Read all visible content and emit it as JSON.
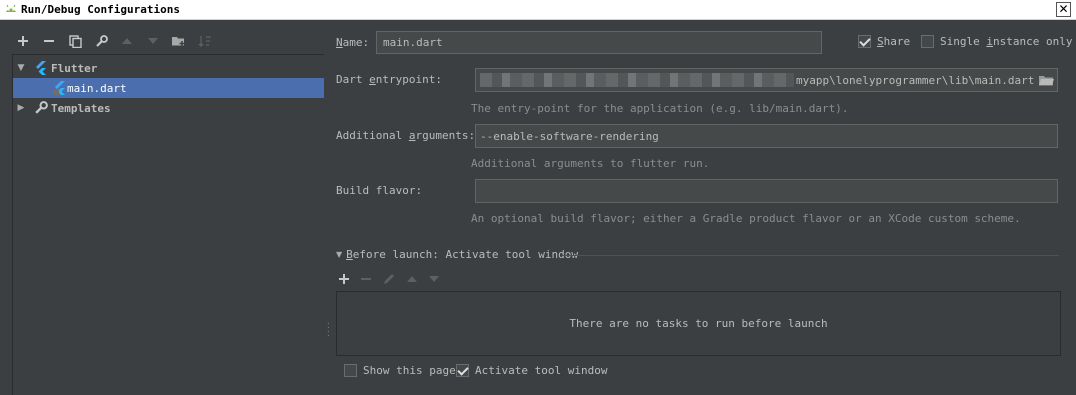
{
  "window": {
    "title": "Run/Debug Configurations",
    "close_glyph": "✕"
  },
  "toolbar": {
    "icons": [
      "add-icon",
      "remove-icon",
      "copy-icon",
      "wrench-icon",
      "move-up-icon",
      "move-down-icon",
      "folder-icon",
      "sort-icon"
    ]
  },
  "tree": {
    "items": [
      {
        "label": "Flutter",
        "expanded": true,
        "icon": "flutter-icon"
      },
      {
        "label": "main.dart",
        "selected": true,
        "icon": "flutter-run-icon"
      },
      {
        "label": "Templates",
        "expanded": false,
        "icon": "wrench-icon"
      }
    ]
  },
  "form": {
    "name_label_u": "N",
    "name_label_rest": "ame:",
    "name_value": "main.dart",
    "share_label_u": "S",
    "share_label_rest": "hare",
    "share_checked": true,
    "single_instance_label_pre": "Single ",
    "single_instance_label_u": "i",
    "single_instance_label_rest": "nstance only",
    "single_instance_checked": false,
    "entrypoint_label_pre": "Dart ",
    "entrypoint_label_u": "e",
    "entrypoint_label_rest": "ntrypoint:",
    "entrypoint_value": "myapp\\lonelyprogrammer\\lib\\main.dart",
    "entrypoint_hint": "The entry-point for the application (e.g. lib/main.dart).",
    "args_label_pre": "Additional ",
    "args_label_u": "a",
    "args_label_rest": "rguments:",
    "args_value": "--enable-software-rendering",
    "args_hint": "Additional arguments to flutter run.",
    "flavor_label": "Build flavor:",
    "flavor_value": "",
    "flavor_hint": "An optional build flavor; either a Gradle product flavor or an XCode custom scheme."
  },
  "before_launch": {
    "title_u": "B",
    "title_rest": "efore launch: Activate tool window",
    "empty_text": "There are no tasks to run before launch",
    "show_page_label": "Show this page",
    "show_page_checked": false,
    "activate_label": "Activate tool window",
    "activate_checked": true
  },
  "colors": {
    "selection": "#4b6eaf",
    "background": "#3c3f41",
    "flutter_blue": "#42a5f5"
  }
}
